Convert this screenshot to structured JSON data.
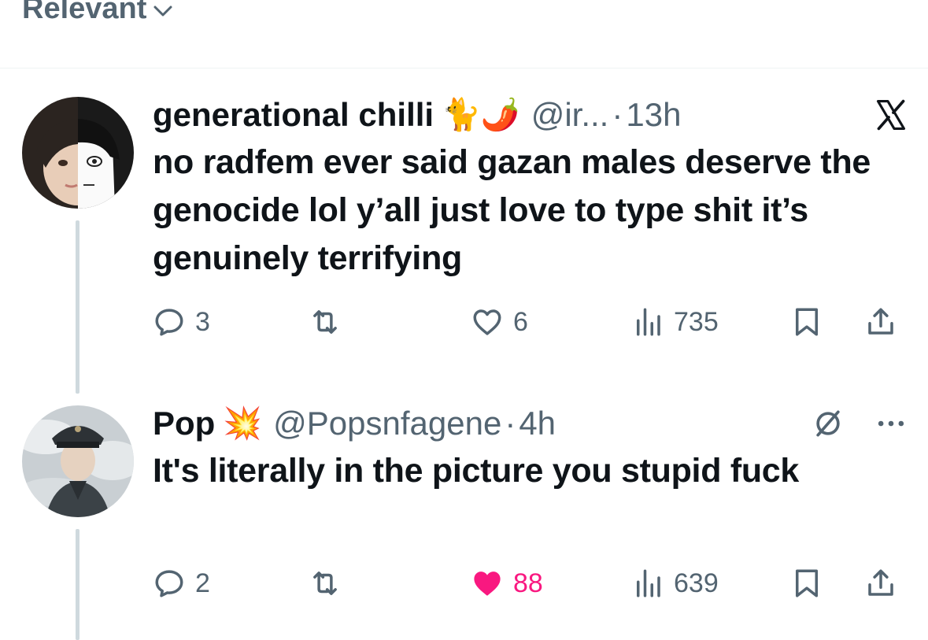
{
  "sort": {
    "label": "Relevant"
  },
  "tweets": [
    {
      "display_name": "generational chilli",
      "emojis": "🐈🌶️",
      "handle": "@ir...",
      "dot": "·",
      "time": "13h",
      "text": "no radfem ever said gazan males deserve the genocide lol y’all just love to type shit it’s genuinely terrifying",
      "replies": "3",
      "retweets": "",
      "likes": "6",
      "views": "735",
      "liked": false,
      "source_icon": "x-logo-icon"
    },
    {
      "display_name": "Pop",
      "emojis": "💥",
      "handle": "@Popsnfagene",
      "dot": "·",
      "time": "4h",
      "text": "It's literally in the picture you stupid fuck",
      "replies": "2",
      "retweets": "",
      "likes": "88",
      "views": "639",
      "liked": true,
      "source_icon": "grok-icon"
    }
  ],
  "colors": {
    "text": "#0f1419",
    "secondary": "#536471",
    "like_active": "#f91880",
    "thread_line": "#cfd9de"
  }
}
